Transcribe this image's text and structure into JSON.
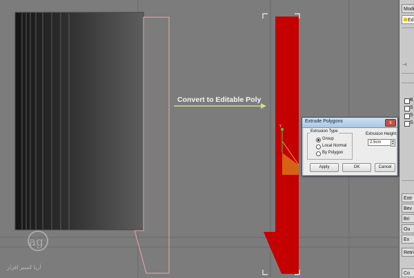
{
  "annotation": {
    "convert_label": "Convert to Editable Poly"
  },
  "dialog": {
    "title": "Extrude Polygons",
    "close_glyph": "x",
    "extrusion_type_label": "Extrusion Type",
    "options": [
      {
        "label": "Group",
        "selected": true
      },
      {
        "label": "Local Normal",
        "selected": false
      },
      {
        "label": "By Polygon",
        "selected": false
      }
    ],
    "height_label": "Extrusion Height:",
    "height_value": "2.5cm",
    "buttons": {
      "apply": "Apply",
      "ok": "OK",
      "cancel": "Cancel"
    }
  },
  "command_panel": {
    "modifier_label": "Modifie",
    "list_item": "Ed",
    "rollout_labels": [
      "B",
      "S",
      "S",
      "S"
    ],
    "buttons": [
      "Extr",
      "Bev",
      "Bri",
      "Ou",
      "Ex",
      "Retri",
      "Co"
    ]
  },
  "watermark": {
    "text": "آریا کسبر افزار"
  },
  "colors": {
    "viewport_bg": "#7c7c7c",
    "red_object": "#c40000",
    "selected_face": "#d86e15",
    "outline_pink": "#e9a8a8",
    "arrow": "#c8e08a",
    "dialog_title": "#a9c7e4"
  },
  "icons": [
    "arrow-right-icon",
    "close-icon",
    "radio-icon",
    "spinner-icon",
    "watermark-logo-icon"
  ]
}
